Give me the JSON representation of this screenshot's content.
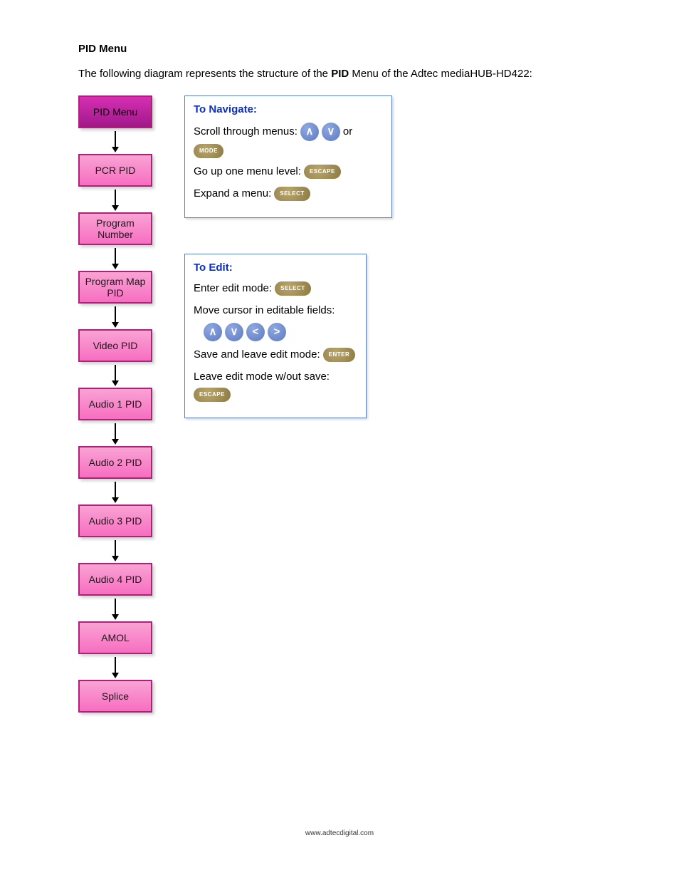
{
  "title": "PID Menu",
  "intro_prefix": "The following diagram represents the structure of the ",
  "intro_bold": "PID",
  "intro_suffix": " Menu of the Adtec mediaHUB-HD422:",
  "flow_nodes": [
    "PID Menu",
    "PCR PID",
    "Program Number",
    "Program Map PID",
    "Video PID",
    "Audio 1 PID",
    "Audio 2 PID",
    "Audio 3 PID",
    "Audio 4 PID",
    "AMOL",
    "Splice"
  ],
  "legend_navigate": {
    "heading": "To Navigate:",
    "scroll_label": "Scroll through menus:",
    "or_label": "or",
    "up_label": "Go up one menu level:",
    "expand_label": "Expand a menu:"
  },
  "legend_edit": {
    "heading": "To Edit:",
    "enter_label": "Enter edit mode:",
    "move_label": "Move cursor in editable fields:",
    "save_label": "Save and leave edit mode:",
    "leave_label": "Leave edit mode w/out save:"
  },
  "buttons": {
    "mode": "MODE",
    "escape": "ESCAPE",
    "select": "SELECT",
    "enter": "ENTER",
    "up": "∧",
    "down": "∨",
    "left": "<",
    "right": ">"
  },
  "footer": "www.adtecdigital.com"
}
